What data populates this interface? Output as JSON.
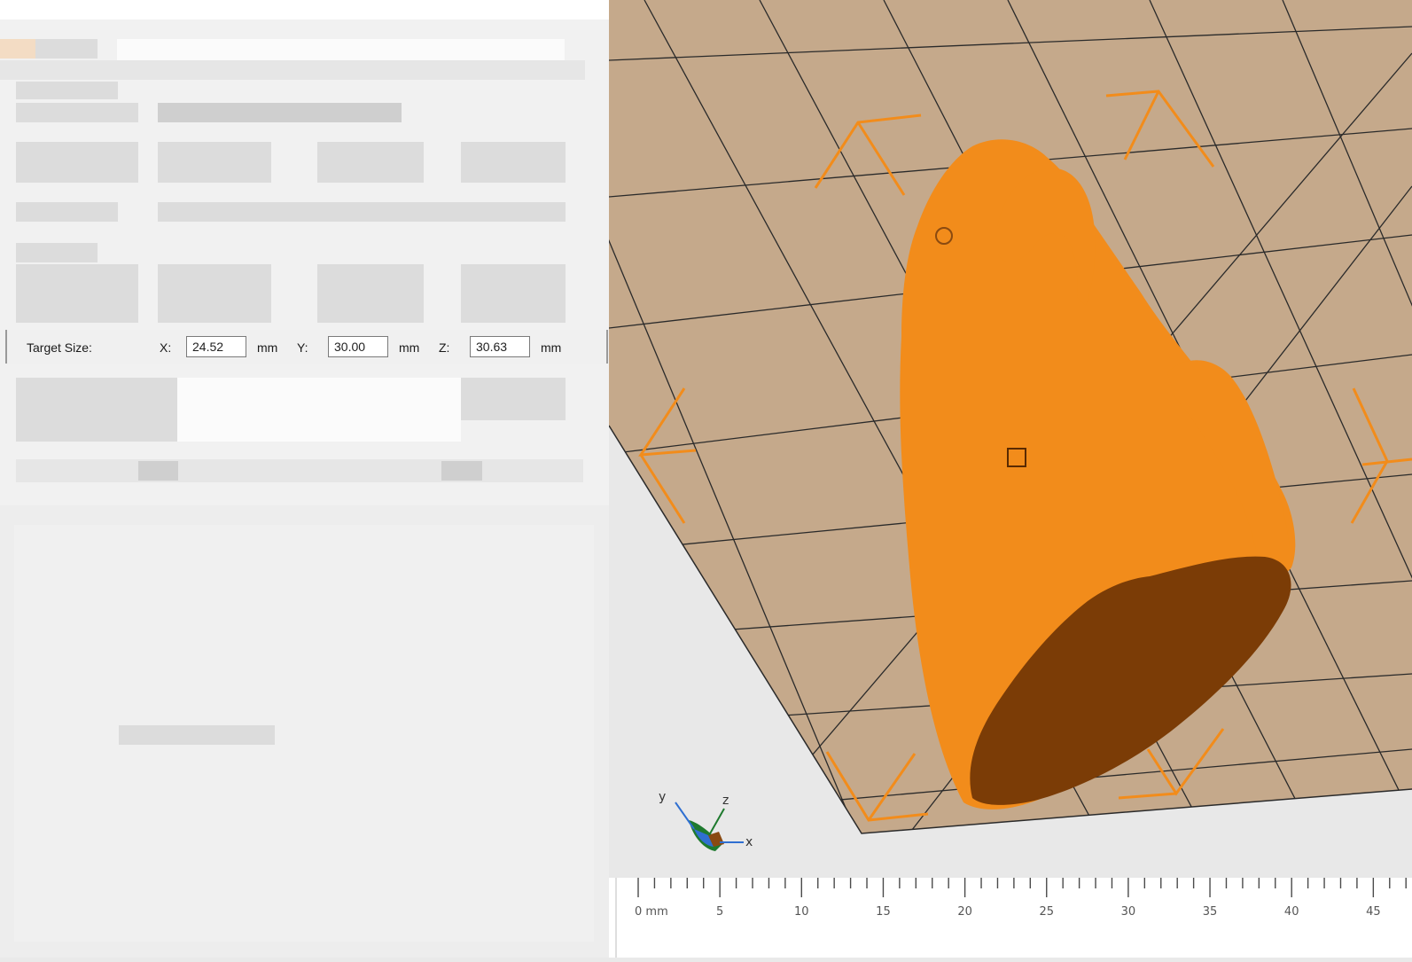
{
  "target_size": {
    "label": "Target Size:",
    "x_label": "X:",
    "x_value": "24.52",
    "y_label": "Y:",
    "y_value": "30.00",
    "z_label": "Z:",
    "z_value": "30.63",
    "unit": "mm"
  },
  "axis_gizmo": {
    "x": "x",
    "y": "y",
    "z": "z"
  },
  "ruler": {
    "ticks": [
      "0 mm",
      "5",
      "10",
      "15",
      "20",
      "25",
      "30",
      "35",
      "40",
      "45"
    ]
  },
  "colors": {
    "model": "#f28c1b",
    "model_cut_face": "#7b3c06",
    "build_plate": "#c5a98b",
    "handles": "#f28c1b"
  }
}
